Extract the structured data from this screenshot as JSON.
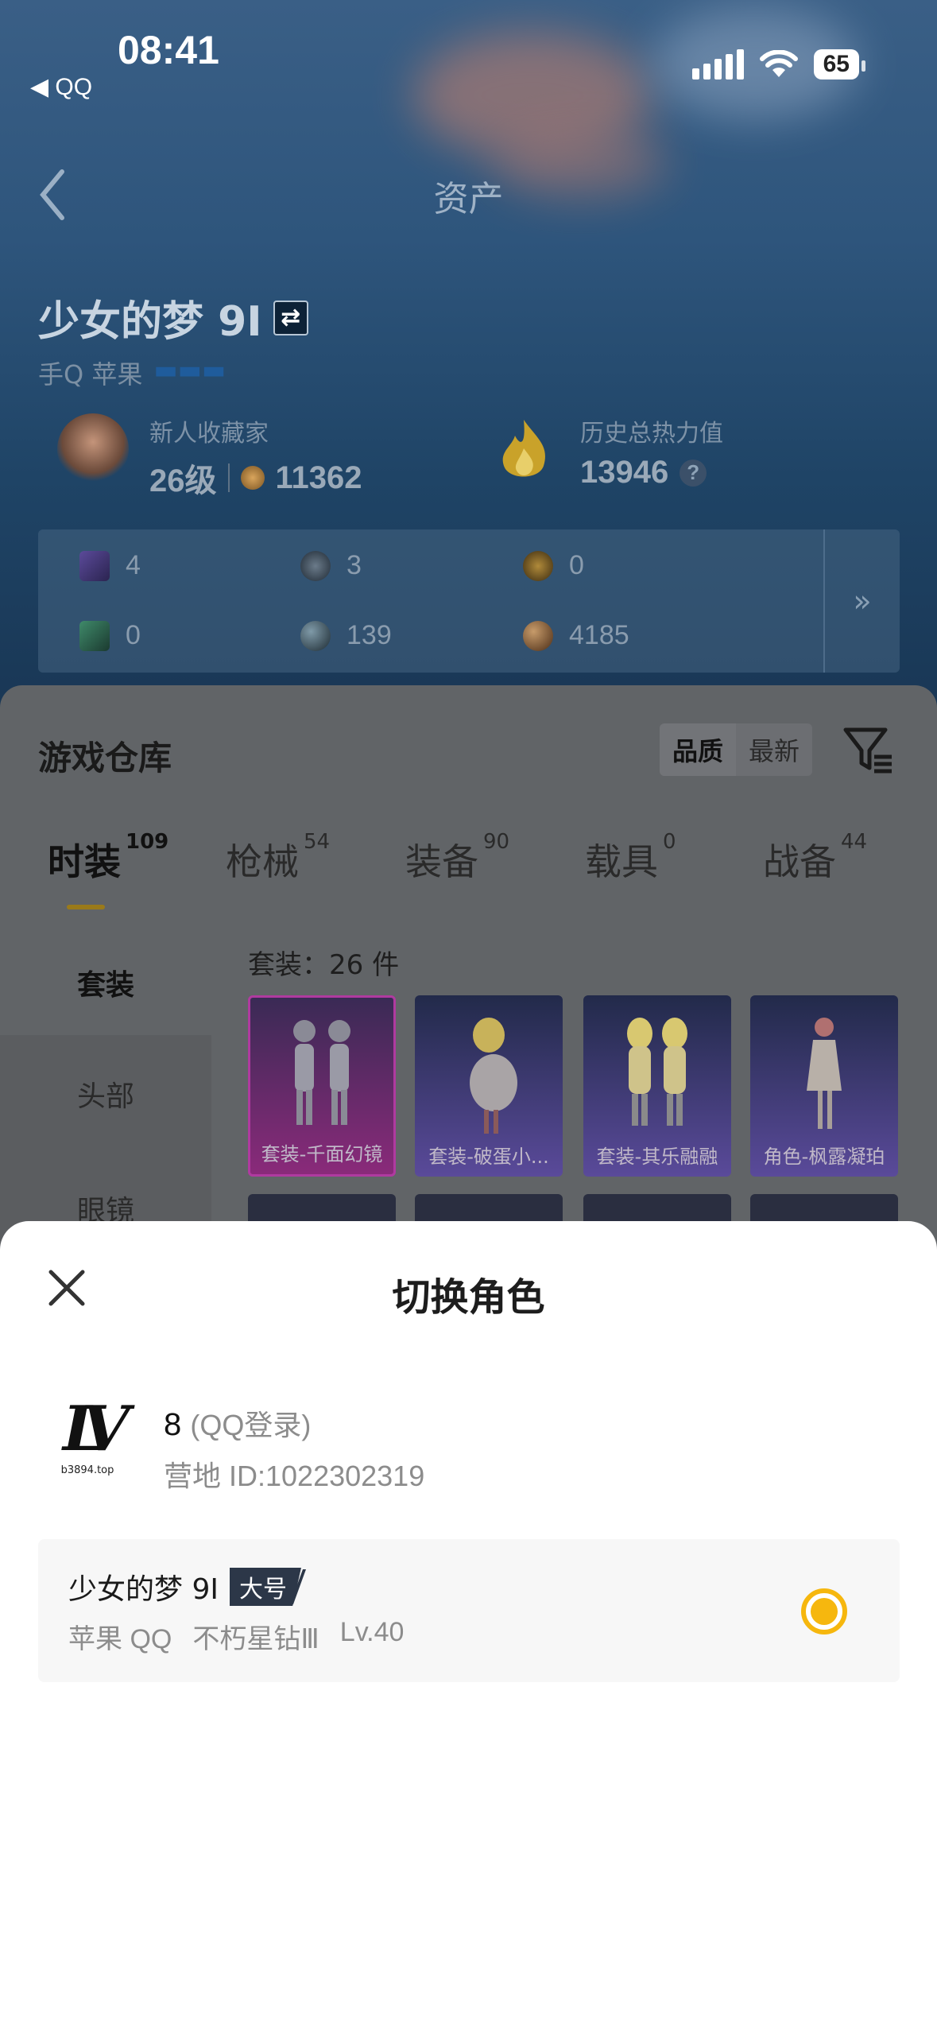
{
  "status_bar": {
    "time": "08:41",
    "back_app": "◀ QQ",
    "battery": "65"
  },
  "header": {
    "title": "资产"
  },
  "profile": {
    "name": "少女的梦 9I",
    "platform": "手Q 苹果",
    "collector_label": "新人收藏家",
    "level": "26级",
    "collection_points": "11362",
    "heat_label": "历史总热力值",
    "heat_value": "13946",
    "help": "?"
  },
  "resources": [
    {
      "icon": "card-purple-icon",
      "value": "4"
    },
    {
      "icon": "coin-silver-icon",
      "value": "3"
    },
    {
      "icon": "coin-gold-icon",
      "value": "0"
    },
    {
      "icon": "card-green-icon",
      "value": "0"
    },
    {
      "icon": "orb-dark-icon",
      "value": "139"
    },
    {
      "icon": "orb-bronze-icon",
      "value": "4185"
    }
  ],
  "resources_more": "»",
  "warehouse": {
    "title": "游戏仓库",
    "sort_options": [
      "品质",
      "最新"
    ],
    "tabs": [
      {
        "label": "时装",
        "count": "109"
      },
      {
        "label": "枪械",
        "count": "54"
      },
      {
        "label": "装备",
        "count": "90"
      },
      {
        "label": "载具",
        "count": "0"
      },
      {
        "label": "战备",
        "count": "44"
      }
    ],
    "categories": [
      "套装",
      "头部",
      "眼镜"
    ],
    "count_text": "套装：26 件",
    "items": [
      {
        "label": "套装-千面幻镜"
      },
      {
        "label": "套装-破蛋小..."
      },
      {
        "label": "套装-其乐融融"
      },
      {
        "label": "角色-枫露凝珀"
      }
    ]
  },
  "sheet": {
    "title": "切换角色",
    "account": {
      "name": "8",
      "login_type": "(QQ登录)",
      "id": "营地 ID:1022302319",
      "avatar_mark": "LV",
      "avatar_url": "b3894.top"
    },
    "role": {
      "name": "少女的梦 9I",
      "badge": "大号",
      "platform": "苹果 QQ",
      "rank": "不朽星钻Ⅲ",
      "level": "Lv.40"
    }
  },
  "colors": {
    "accent_yellow": "#f6b70e",
    "badge_bg": "#2c3748"
  }
}
